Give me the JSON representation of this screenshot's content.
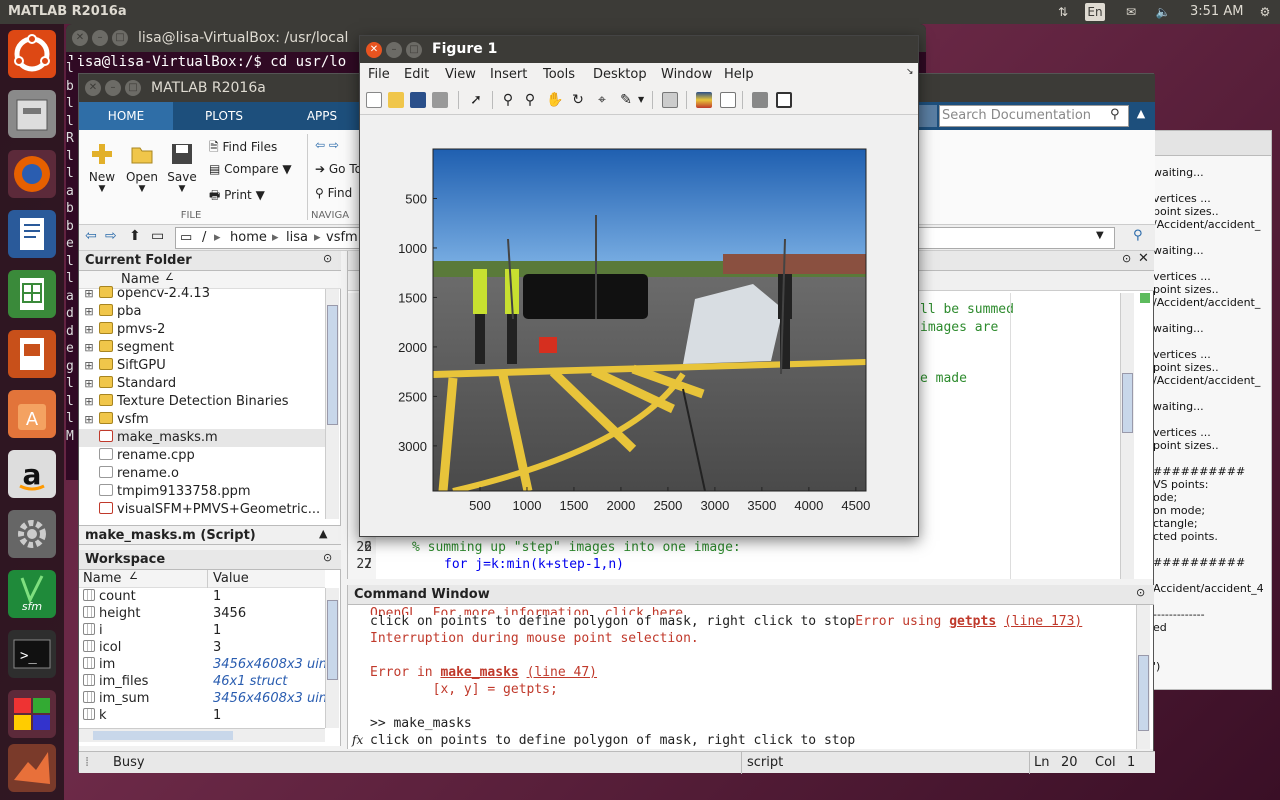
{
  "topbar": {
    "app": "MATLAB R2016a",
    "lang": "En",
    "time": "3:51 AM"
  },
  "terminal": {
    "title": "lisa@lisa-VirtualBox: /usr/local",
    "command": "lisa@lisa-VirtualBox:/$ cd usr/lo",
    "left_letters": [
      "l",
      "b",
      "l",
      "l",
      "R",
      "l",
      "l",
      "a",
      "b",
      "b",
      "e",
      "l",
      "l",
      "a",
      "d",
      "d",
      "e",
      "g",
      "l",
      "l",
      "l",
      "M"
    ]
  },
  "matlab": {
    "title": "MATLAB R2016a",
    "tabs": [
      "HOME",
      "PLOTS",
      "APPS"
    ],
    "ribbon": {
      "new": "New",
      "open": "Open",
      "save": "Save",
      "find_files": "Find Files",
      "compare": "Compare",
      "print": "Print",
      "file_group": "FILE",
      "go_to": "Go To",
      "find": "Find",
      "nav_group": "NAVIGA"
    },
    "search_placeholder": "Search Documentation",
    "path": [
      "/",
      "home",
      "lisa",
      "vsfm"
    ],
    "current_folder": {
      "title": "Current Folder",
      "col_name": "Name",
      "items": [
        {
          "name": "opencv-2.4.13",
          "type": "folder"
        },
        {
          "name": "pba",
          "type": "folder"
        },
        {
          "name": "pmvs-2",
          "type": "folder"
        },
        {
          "name": "segment",
          "type": "folder"
        },
        {
          "name": "SiftGPU",
          "type": "folder"
        },
        {
          "name": "Standard",
          "type": "folder"
        },
        {
          "name": "Texture Detection Binaries",
          "type": "folder"
        },
        {
          "name": "vsfm",
          "type": "folder"
        },
        {
          "name": "make_masks.m",
          "type": "mfile"
        },
        {
          "name": "rename.cpp",
          "type": "file"
        },
        {
          "name": "rename.o",
          "type": "file"
        },
        {
          "name": "tmpim9133758.ppm",
          "type": "file"
        },
        {
          "name": "visualSFM+PMVS+Geometric...",
          "type": "pdf"
        }
      ]
    },
    "details": "make_masks.m  (Script)",
    "workspace": {
      "title": "Workspace",
      "col_name": "Name",
      "col_value": "Value",
      "vars": [
        {
          "name": "count",
          "value": "1",
          "italic": false
        },
        {
          "name": "height",
          "value": "3456",
          "italic": false
        },
        {
          "name": "i",
          "value": "1",
          "italic": false
        },
        {
          "name": "icol",
          "value": "3",
          "italic": false
        },
        {
          "name": "im",
          "value": "3456x4608x3 uin",
          "italic": true
        },
        {
          "name": "im_files",
          "value": "46x1 struct",
          "italic": true
        },
        {
          "name": "im_sum",
          "value": "3456x4608x3 uin",
          "italic": true
        },
        {
          "name": "k",
          "value": "1",
          "italic": false
        }
      ]
    },
    "editor": {
      "line_nums": [
        "1",
        "1",
        "1",
        "1",
        "1",
        "1",
        "1",
        "1",
        "1",
        "1",
        "2",
        "2",
        "2",
        "2",
        "2",
        "2",
        "26",
        "27"
      ],
      "frag1": "ll be summed",
      "frag2": "images are",
      "frag3": "e made",
      "comment": "% summing up \"step\" images into one image:",
      "loop": "for j=k:min(k+step-1,n)"
    },
    "command_window": {
      "title": "Command Window",
      "clipped": "OpenGL. For more information, click here.",
      "line1": "click on points to define polygon of mask, right click to stop",
      "err1a": "Error using ",
      "err1fn": "getpts",
      "err1ln": "(line 173)",
      "err2": "Interruption during mouse point selection.",
      "err3a": "Error in ",
      "err3fn": "make_masks",
      "err3ln": "(line 47)",
      "err4": "        [x, y] = getpts;",
      "prompt": ">> make_masks",
      "line2": "click on points to define polygon of mask, right click to stop",
      "fx": "fx"
    },
    "status": {
      "state": "Busy",
      "mode": "script",
      "ln_label": "Ln",
      "ln": "20",
      "col_label": "Col",
      "col": "1"
    }
  },
  "right_panel": {
    "lines": [
      "waiting...",
      "",
      "vertices ...",
      "point sizes..",
      "/Accident/accident_",
      "",
      "waiting...",
      "",
      "vertices ...",
      "point sizes..",
      "/Accident/accident_",
      "",
      "waiting...",
      "",
      "vertices ...",
      "point sizes..",
      "/Accident/accident_",
      "",
      "waiting...",
      "",
      "vertices ...",
      "point sizes..",
      "",
      "##########",
      "VS points:",
      "ode;",
      "on mode;",
      "ctangle;",
      "cted points.",
      "",
      "##########",
      "",
      "Accident/accident_4",
      "",
      "-------------",
      "ed",
      "",
      "",
      "')"
    ]
  },
  "figure": {
    "title": "Figure 1",
    "menu": [
      "File",
      "Edit",
      "View",
      "Insert",
      "Tools",
      "Desktop",
      "Window",
      "Help"
    ],
    "chart_data": {
      "type": "image",
      "x_ticks": [
        500,
        1000,
        1500,
        2000,
        2500,
        3000,
        3500,
        4000,
        4500
      ],
      "y_ticks": [
        500,
        1000,
        1500,
        2000,
        2500,
        3000
      ],
      "xlim": [
        0,
        4608
      ],
      "ylim": [
        0,
        3456
      ],
      "y_reversed": true
    }
  }
}
